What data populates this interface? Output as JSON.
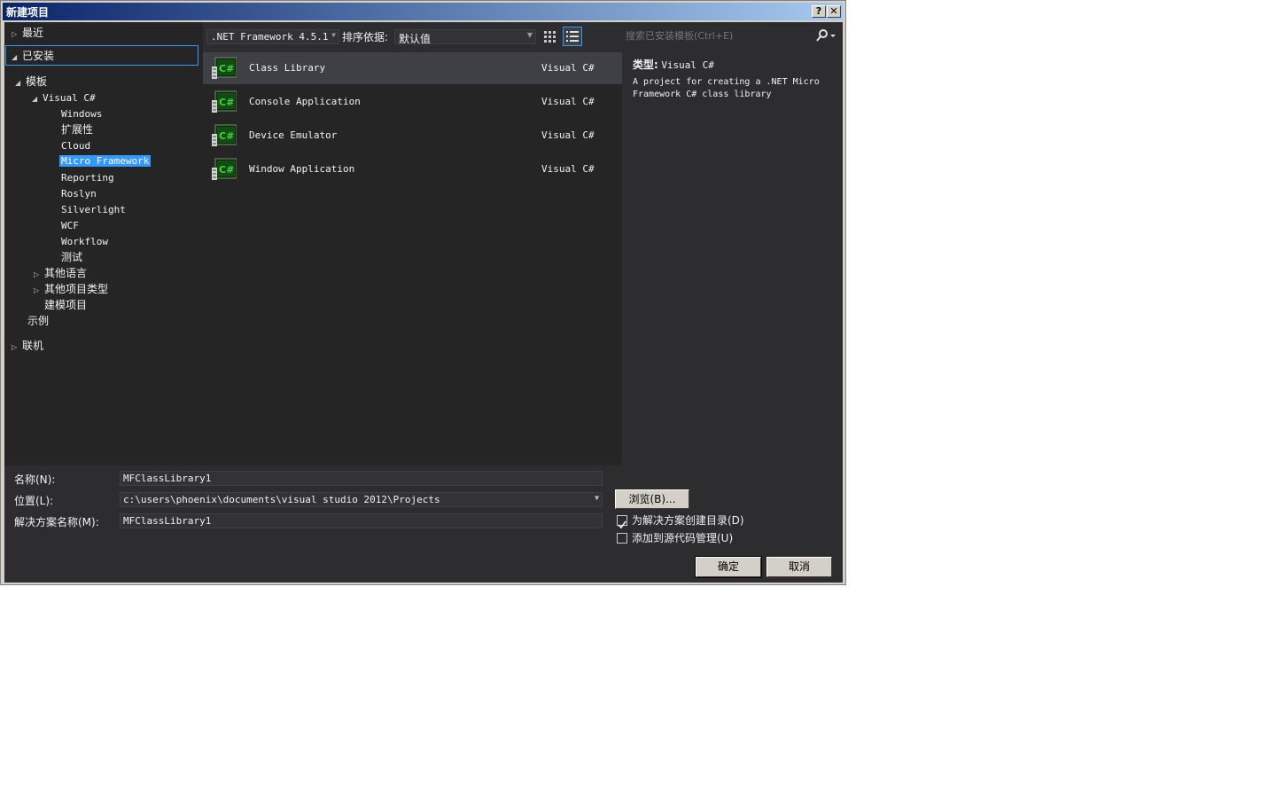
{
  "window": {
    "title": "新建项目",
    "help_label": "?",
    "close_label": "✕"
  },
  "tree": {
    "recent": "最近",
    "installed": "已安装",
    "templates": "模板",
    "visual_csharp": "Visual C#",
    "csharp_children": [
      "Windows",
      "扩展性",
      "Cloud",
      "Micro Framework",
      "Reporting",
      "Roslyn",
      "Silverlight",
      "WCF",
      "Workflow",
      "测试"
    ],
    "other_languages": "其他语言",
    "other_project_types": "其他项目类型",
    "modeling_projects": "建模项目",
    "samples": "示例",
    "online": "联机"
  },
  "toolbar": {
    "framework": ".NET Framework 4.5.1",
    "sort_label": "排序依据:",
    "sort_value": "默认值"
  },
  "search": {
    "placeholder": "搜索已安装模板(Ctrl+E)"
  },
  "templates": [
    {
      "name": "Class Library",
      "lang": "Visual C#"
    },
    {
      "name": "Console Application",
      "lang": "Visual C#"
    },
    {
      "name": "Device Emulator",
      "lang": "Visual C#"
    },
    {
      "name": "Window Application",
      "lang": "Visual C#"
    }
  ],
  "details": {
    "type_label": "类型:",
    "type_value": "Visual C#",
    "description": "A project for creating a .NET Micro Framework C# class library"
  },
  "form": {
    "name_label": "名称(N):",
    "name_value": "MFClassLibrary1",
    "location_label": "位置(L):",
    "location_value": "c:\\users\\phoenix\\documents\\visual studio 2012\\Projects",
    "solution_label": "解决方案名称(M):",
    "solution_value": "MFClassLibrary1",
    "browse_label": "浏览(B)...",
    "create_dir_label": "为解决方案创建目录(D)",
    "source_control_label": "添加到源代码管理(U)",
    "ok_label": "确定",
    "cancel_label": "取消"
  },
  "colors": {
    "selection": "#3399ff",
    "background": "#2d2d30",
    "panel": "#252526"
  }
}
